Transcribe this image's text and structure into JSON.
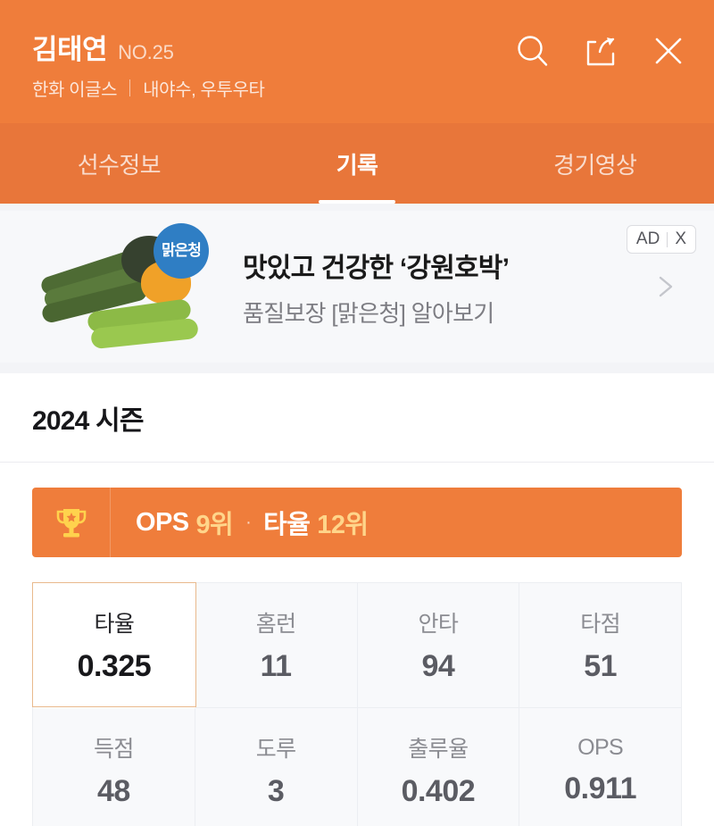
{
  "header": {
    "player_name": "김태연",
    "player_number": "NO.25",
    "team": "한화 이글스",
    "position": "내야수, 우투우타",
    "icons": {
      "search": "search-icon",
      "share": "share-icon",
      "close": "close-icon"
    },
    "background_color": "#ef7d3b"
  },
  "tabs": [
    {
      "label": "선수정보",
      "active": false
    },
    {
      "label": "기록",
      "active": true
    },
    {
      "label": "경기영상",
      "active": false
    }
  ],
  "ad": {
    "title": "맛있고 건강한 ‘강원호박’",
    "description": "품질보장 [맑은청] 알아보기",
    "badge_label": "AD",
    "close_label": "X",
    "brand_logo_text": "맑은청",
    "chevron": "chevron-right-icon"
  },
  "season": {
    "title": "2024 시즌"
  },
  "rank_banner": {
    "icon": "trophy-icon",
    "items": [
      {
        "label": "OPS",
        "rank": "9위"
      },
      {
        "label": "타율",
        "rank": "12위"
      }
    ],
    "separator": "·",
    "background_color": "#ef7d3b",
    "rank_color": "#ffd58a"
  },
  "stats": [
    {
      "label": "타율",
      "value": "0.325",
      "selected": true
    },
    {
      "label": "홈런",
      "value": "11",
      "selected": false
    },
    {
      "label": "안타",
      "value": "94",
      "selected": false
    },
    {
      "label": "타점",
      "value": "51",
      "selected": false
    },
    {
      "label": "득점",
      "value": "48",
      "selected": false
    },
    {
      "label": "도루",
      "value": "3",
      "selected": false
    },
    {
      "label": "출루율",
      "value": "0.402",
      "selected": false
    },
    {
      "label": "OPS",
      "value": "0.911",
      "selected": false
    }
  ]
}
